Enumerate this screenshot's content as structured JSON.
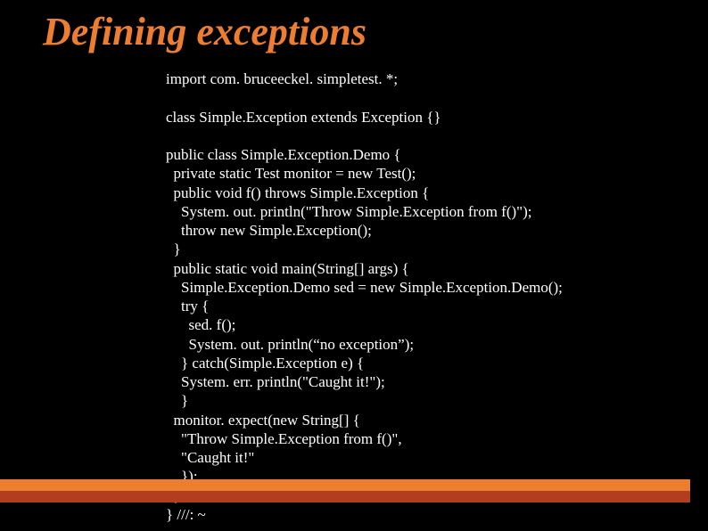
{
  "slide": {
    "title": "Defining exceptions",
    "code": "import com. bruceeckel. simpletest. *;\n\nclass Simple.Exception extends Exception {}\n\npublic class Simple.Exception.Demo {\n  private static Test monitor = new Test();\n  public void f() throws Simple.Exception {\n    System. out. println(\"Throw Simple.Exception from f()\");\n    throw new Simple.Exception();\n  }\n  public static void main(String[] args) {\n    Simple.Exception.Demo sed = new Simple.Exception.Demo();\n    try {\n      sed. f();\n      System. out. println(“no exception”);\n    } catch(Simple.Exception e) {\n    System. err. println(\"Caught it!\");\n    }\n  monitor. expect(new String[] {\n    \"Throw Simple.Exception from f()\",\n    \"Caught it!\"\n    });\n  }\n} ///: ~"
  }
}
